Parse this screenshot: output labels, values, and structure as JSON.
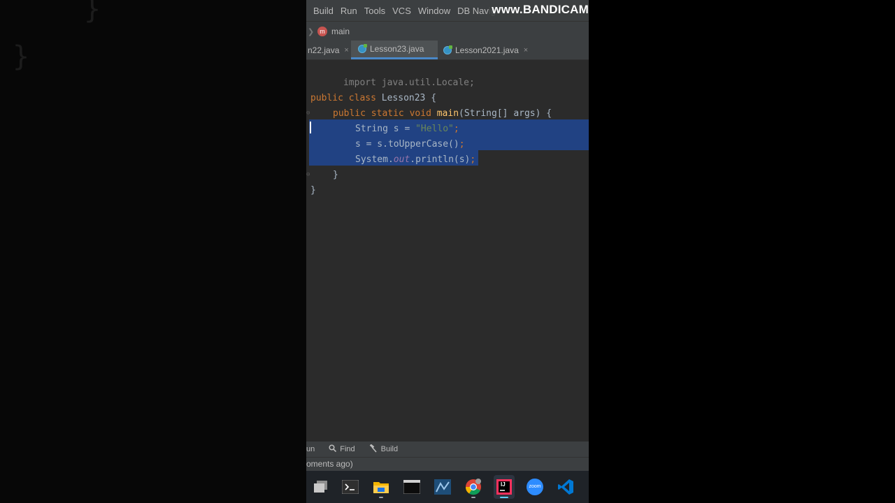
{
  "menu": [
    "Build",
    "Run",
    "Tools",
    "VCS",
    "Window",
    "DB Navig"
  ],
  "watermark": "www.BANDICAM",
  "navbar": {
    "method_badge": "m",
    "method": "main"
  },
  "tabs": [
    {
      "label": "n22.java",
      "active": false,
      "close": "×"
    },
    {
      "label": "Lesson23.java",
      "active": true,
      "close": ""
    },
    {
      "label": "Lesson2021.java",
      "active": false,
      "close": "×"
    }
  ],
  "code": {
    "import": "import java.util.Locale;",
    "class_decl": [
      "public",
      "class",
      "Lesson23 {"
    ],
    "method_decl": [
      "public",
      "static",
      "void",
      "main",
      "(String[] args) {"
    ],
    "line1": [
      "String s = ",
      "\"Hello\"",
      ";"
    ],
    "line2": [
      "s = s.toUpperCase()",
      ";"
    ],
    "line3": [
      "System.",
      "out",
      ".println(s)",
      ";"
    ],
    "close_method": "}",
    "close_class": "}"
  },
  "background_ghost": [
    "}",
    "}"
  ],
  "toolwindows": [
    {
      "icon": "run-icon",
      "label": "un"
    },
    {
      "icon": "search-icon",
      "label": "Find"
    },
    {
      "icon": "hammer-icon",
      "label": "Build"
    }
  ],
  "status_text": "oments ago)",
  "taskbar_apps": [
    "explorer-app",
    "terminal-app",
    "files-app",
    "console-app",
    "git-app",
    "chrome-app",
    "intellij-app",
    "zoom-app",
    "vscode-app"
  ],
  "zoom_label": "zoom",
  "intellij_label": "IJ",
  "colors": {
    "selection": "#214283",
    "keyword": "#cc7832",
    "string": "#6a8759",
    "method": "#ffc66d",
    "field": "#9876aa",
    "tab_underline": "#4a88c7"
  }
}
